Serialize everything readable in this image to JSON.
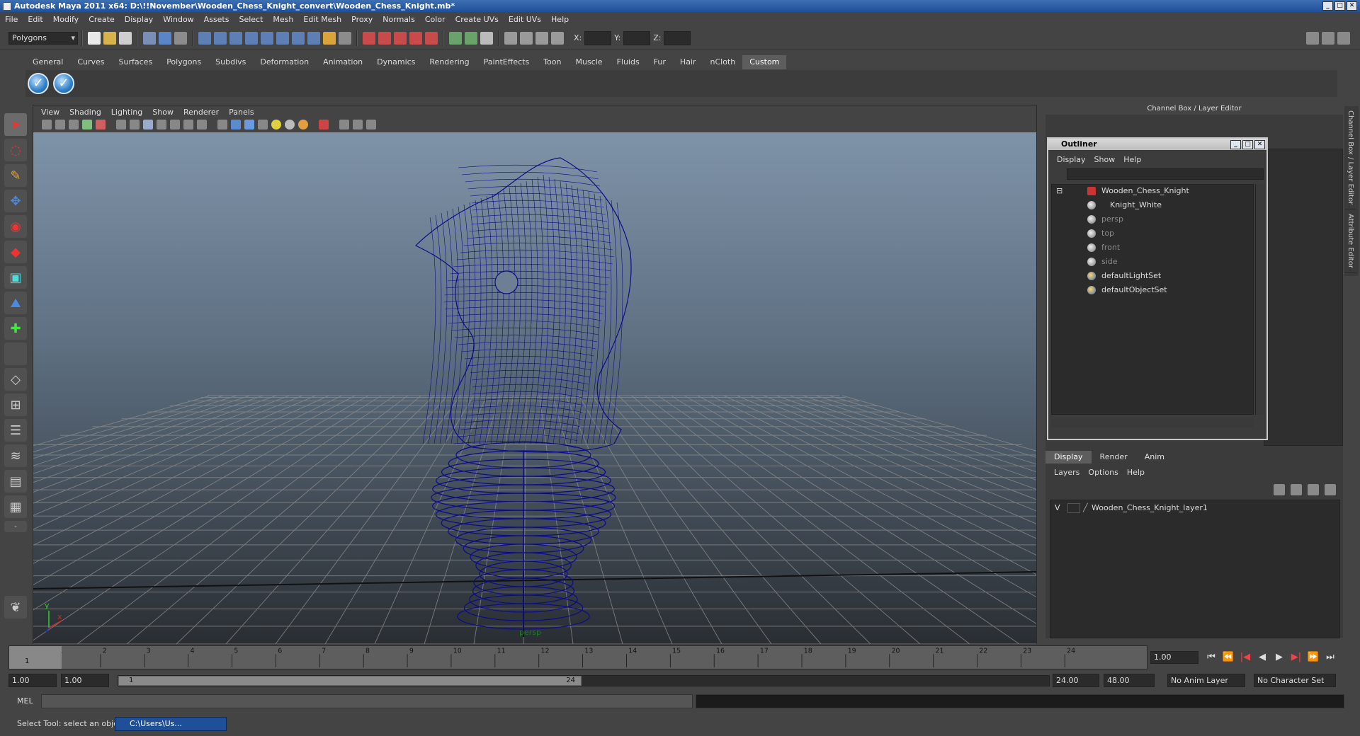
{
  "window": {
    "title": "Autodesk Maya 2011 x64: D:\\!!November\\Wooden_Chess_Knight_convert\\Wooden_Chess_Knight.mb*",
    "min": "_",
    "max": "□",
    "close": "✕"
  },
  "menu": [
    "File",
    "Edit",
    "Modify",
    "Create",
    "Display",
    "Window",
    "Assets",
    "Select",
    "Mesh",
    "Edit Mesh",
    "Proxy",
    "Normals",
    "Color",
    "Create UVs",
    "Edit UVs",
    "Help"
  ],
  "statusline": {
    "mode": "Polygons",
    "x_label": "X:",
    "y_label": "Y:",
    "z_label": "Z:"
  },
  "shelf": {
    "tabs": [
      "General",
      "Curves",
      "Surfaces",
      "Polygons",
      "Subdivs",
      "Deformation",
      "Animation",
      "Dynamics",
      "Rendering",
      "PaintEffects",
      "Toon",
      "Muscle",
      "Fluids",
      "Fur",
      "Hair",
      "nCloth",
      "Custom"
    ],
    "active": "Custom",
    "icon_glyph": "✓"
  },
  "viewport": {
    "menu": [
      "View",
      "Shading",
      "Lighting",
      "Show",
      "Renderer",
      "Panels"
    ],
    "camera_label": "persp",
    "axis_x": "x",
    "axis_y": "y"
  },
  "timeline": {
    "ticks": [
      "1",
      "2",
      "3",
      "4",
      "5",
      "6",
      "7",
      "8",
      "9",
      "10",
      "11",
      "12",
      "13",
      "14",
      "15",
      "16",
      "17",
      "18",
      "19",
      "20",
      "21",
      "22",
      "23",
      "24"
    ],
    "current_frame": "1",
    "current_time": "1.00",
    "playback_glyphs": [
      "⏮",
      "⏪",
      "|◀",
      "◀",
      "▶",
      "▶|",
      "⏩",
      "⏭"
    ]
  },
  "range": {
    "start": "1.00",
    "start_inner": "1.00",
    "slider_start": "1",
    "slider_end": "24",
    "end": "24.00",
    "end_outer": "48.00",
    "anim_layer": "No Anim Layer",
    "char_set": "No Character Set"
  },
  "cmd": {
    "label": "MEL"
  },
  "help": {
    "text": "Select Tool: select an object",
    "taskbar": "C:\\Users\\Us..."
  },
  "channel_box": {
    "title": "Channel Box / Layer Editor",
    "side_tabs": [
      "Channel Box / Layer Editor",
      "Attribute Editor"
    ]
  },
  "outliner": {
    "title": "Outliner",
    "menu": [
      "Display",
      "Show",
      "Help"
    ],
    "items": [
      {
        "label": "Wooden_Chess_Knight",
        "dim": false
      },
      {
        "label": "Knight_White",
        "dim": false
      },
      {
        "label": "persp",
        "dim": true
      },
      {
        "label": "top",
        "dim": true
      },
      {
        "label": "front",
        "dim": true
      },
      {
        "label": "side",
        "dim": true
      },
      {
        "label": "defaultLightSet",
        "dim": false
      },
      {
        "label": "defaultObjectSet",
        "dim": false
      }
    ]
  },
  "layers": {
    "tabs": [
      "Display",
      "Render",
      "Anim"
    ],
    "active": "Display",
    "menu": [
      "Layers",
      "Options",
      "Help"
    ],
    "row": {
      "visible": "V",
      "name": "Wooden_Chess_Knight_layer1"
    }
  },
  "colors": {
    "wire": "#101080",
    "accent": "#1f4f99"
  }
}
